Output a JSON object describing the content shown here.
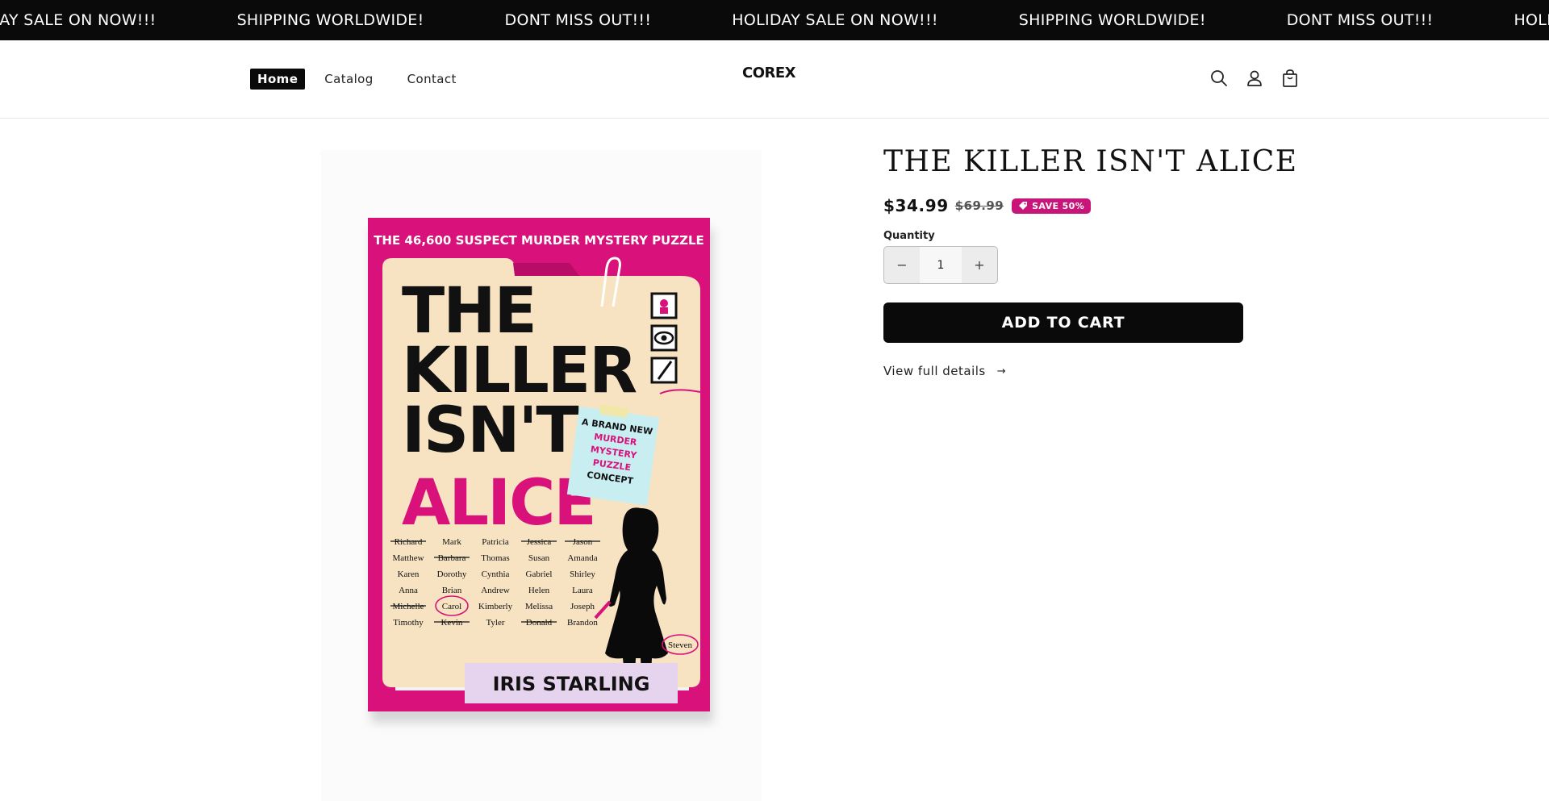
{
  "announcements": [
    "HOLIDAY SALE ON NOW!!!",
    "SHIPPING WORLDWIDE!",
    "DONT MISS OUT!!!",
    "HOLIDAY SALE ON NOW!!!",
    "SHIPPING WORLDWIDE!",
    "DONT MISS OUT!!!",
    "HOLIDAY SALE ON NOW!!!"
  ],
  "nav": {
    "home": "Home",
    "catalog": "Catalog",
    "contact": "Contact"
  },
  "brand": "COREX",
  "header_icons": [
    "search-icon",
    "account-icon",
    "cart-icon"
  ],
  "product": {
    "title": "THE KILLER ISN'T ALICE",
    "price": "$34.99",
    "compare_price": "$69.99",
    "badge": "SAVE 50%",
    "quantity_label": "Quantity",
    "quantity": "1",
    "minus": "−",
    "plus": "+",
    "add_to_cart": "ADD TO CART",
    "view_details": "View full details",
    "details_arrow": "→"
  },
  "cover": {
    "tagline": "THE 46,600 SUSPECT MURDER MYSTERY PUZZLE",
    "title_lines": [
      "THE",
      "KILLER",
      "ISN'T"
    ],
    "title_accent": "ALICE",
    "sticky_note": [
      "A BRAND NEW",
      "MURDER",
      "MYSTERY",
      "PUZZLE",
      "CONCEPT"
    ],
    "names": [
      [
        "Richard",
        "Mark",
        "Patricia",
        "Jessica",
        "Jason"
      ],
      [
        "Matthew",
        "Barbara",
        "Thomas",
        "Susan",
        "Amanda"
      ],
      [
        "Karen",
        "Dorothy",
        "Cynthia",
        "Gabriel",
        "Shirley"
      ],
      [
        "Anna",
        "Brian",
        "Andrew",
        "Helen",
        "Laura"
      ],
      [
        "Michelle",
        "Carol",
        "Kimberly",
        "Melissa",
        "Joseph"
      ],
      [
        "Timothy",
        "Kevin",
        "Tyler",
        "Donald",
        "Brandon"
      ]
    ],
    "struck": [
      "Richard",
      "Jessica",
      "Jason",
      "Barbara",
      "Michelle",
      "Kevin",
      "Donald"
    ],
    "circled": [
      "Carol"
    ],
    "extra_name": "Steven",
    "author": "IRIS STARLING"
  },
  "colors": {
    "accent": "#c8157a",
    "cover_pink": "#d8127a",
    "folder": "#f7e3c2",
    "sticky": "#c9eef2",
    "author_band": "#e6d3ee",
    "button": "#0a0a0a"
  }
}
